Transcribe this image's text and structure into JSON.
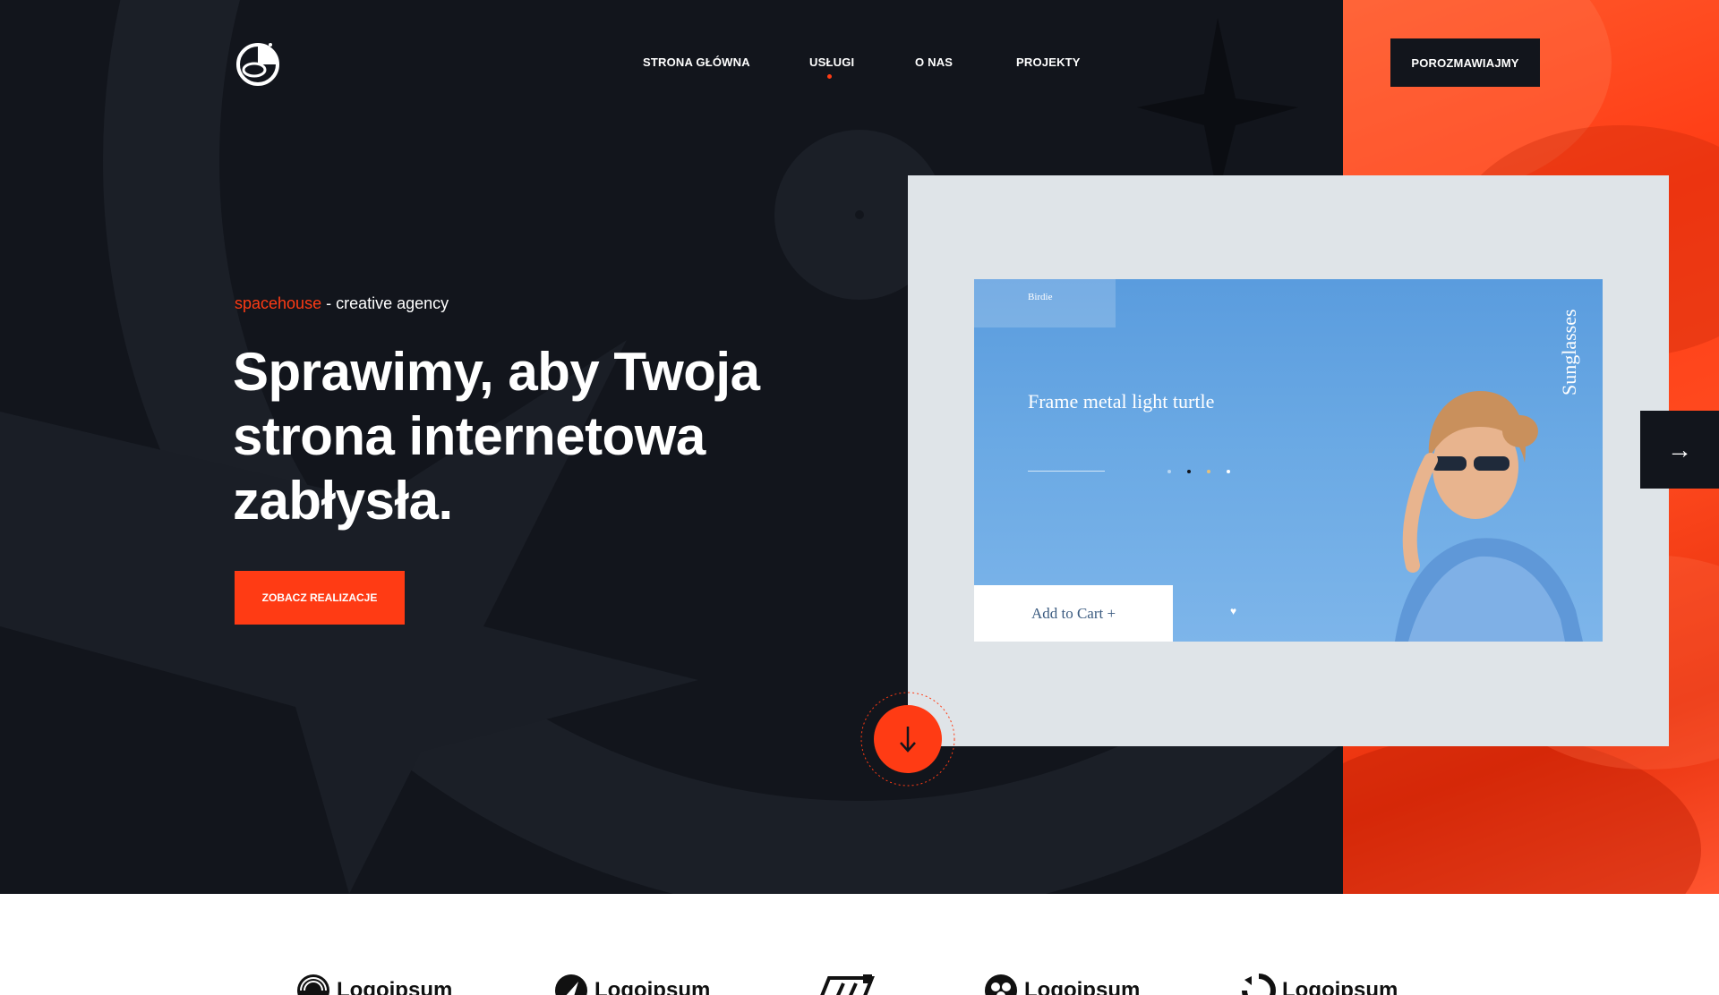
{
  "header": {
    "logo_name": "spacehouse-astronaut-logo",
    "nav": [
      {
        "label": "STRONA GŁÓWNA",
        "active": false
      },
      {
        "label": "USŁUGI",
        "active": true
      },
      {
        "label": "O NAS",
        "active": false
      },
      {
        "label": "PROJEKTY",
        "active": false
      }
    ],
    "cta_label": "POROZMAWIAJMY"
  },
  "hero": {
    "brand": "spacehouse",
    "tagline_rest": " - creative agency",
    "headline_line1": "Sprawimy, aby Twoja",
    "headline_line2": "strona internetowa",
    "headline_line3": "zabłysła.",
    "cta_label": "ZOBACZ REALIZACJE"
  },
  "showcase": {
    "mock_brand": "Birdie",
    "mock_product_title": "Frame metal light turtle",
    "mock_side_label": "Sunglasses",
    "mock_cart_label": "Add to Cart +"
  },
  "controls": {
    "next_icon": "arrow-right-icon",
    "scroll_icon": "arrow-down-icon"
  },
  "clients": {
    "logos": [
      "Logoipsum",
      "Logoipsum",
      "",
      "Logoipsum",
      "Logoipsum"
    ]
  },
  "colors": {
    "accent": "#ff3b14",
    "dark": "#12151c",
    "showcase_bg": "#dfe4e8",
    "mock_blue": "#6aa9e4"
  }
}
